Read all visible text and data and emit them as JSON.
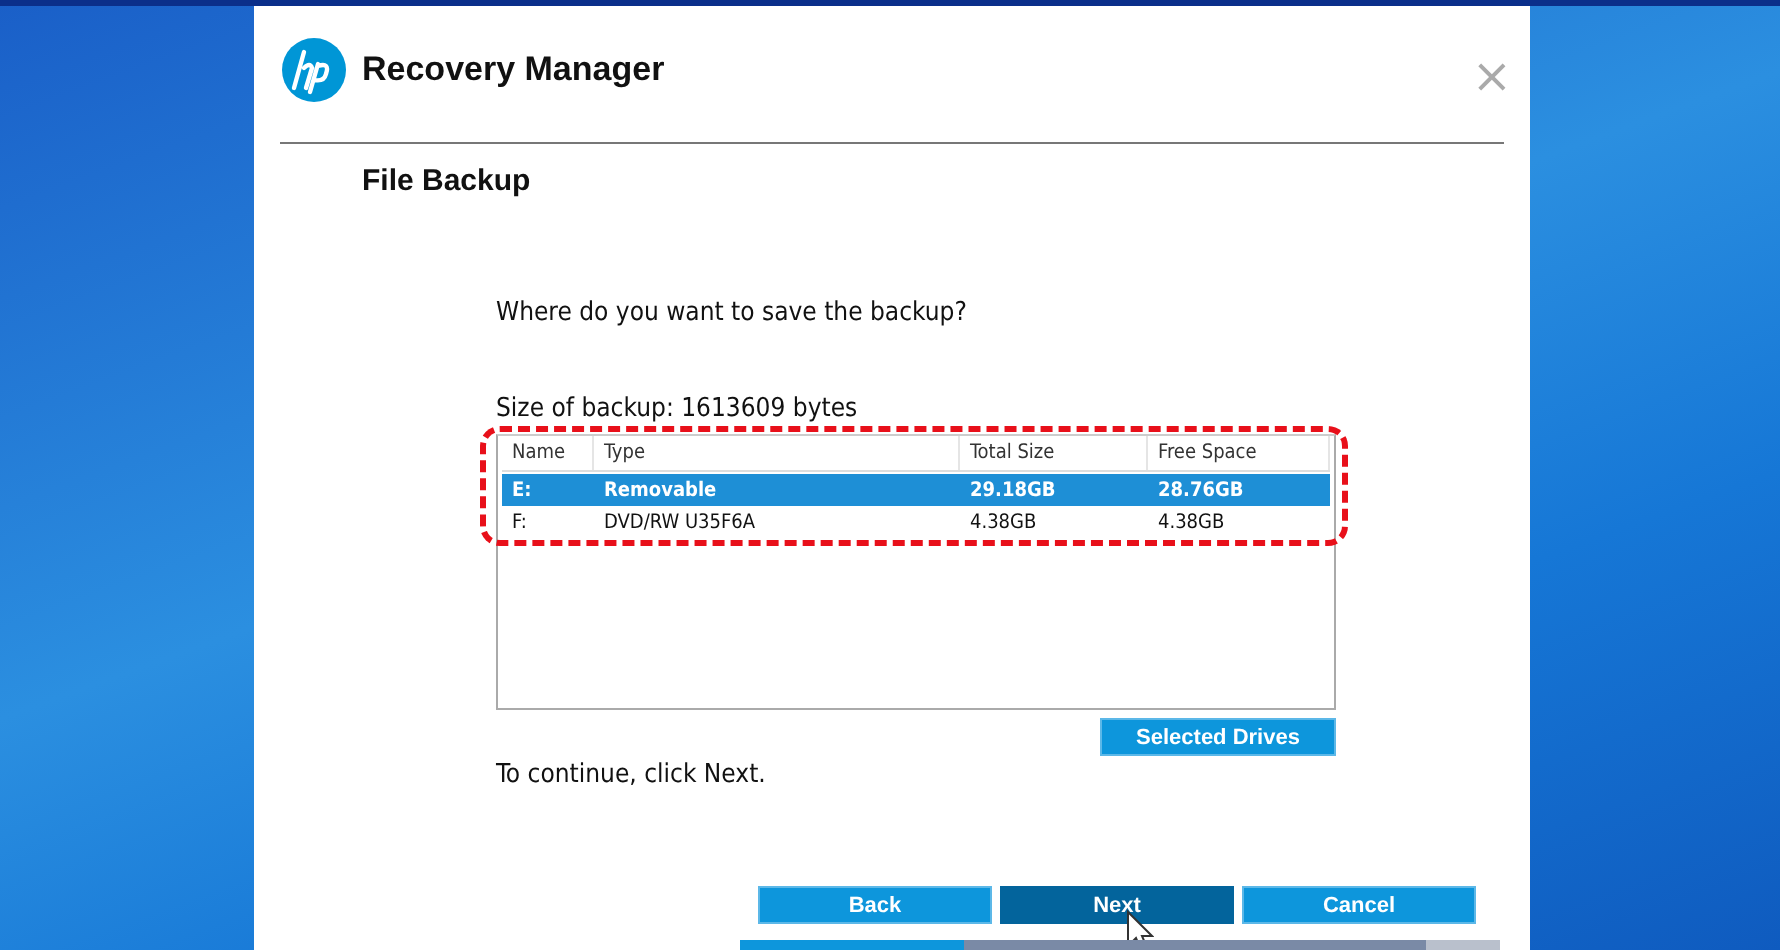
{
  "window": {
    "title": "Recovery Manager",
    "close": "×"
  },
  "page": {
    "title": "File Backup"
  },
  "prompt": "Where do you want to save the backup?",
  "backup_size": "Size of backup: 1613609 bytes",
  "table": {
    "columns": [
      "Name",
      "Type",
      "Total Size",
      "Free Space"
    ],
    "rows": [
      {
        "cells": [
          "E:",
          "Removable",
          "29.18GB",
          "28.76GB"
        ],
        "selected": true
      },
      {
        "cells": [
          "F:",
          "DVD/RW U35F6A",
          "4.38GB",
          "4.38GB"
        ],
        "selected": false
      }
    ],
    "highlighted": true
  },
  "selected_drives_button": "Selected Drives",
  "hint": "To continue, click Next.",
  "buttons": [
    {
      "label": "Back",
      "focused": false
    },
    {
      "label": "Next",
      "focused": true
    },
    {
      "label": "Cancel",
      "focused": false
    }
  ]
}
